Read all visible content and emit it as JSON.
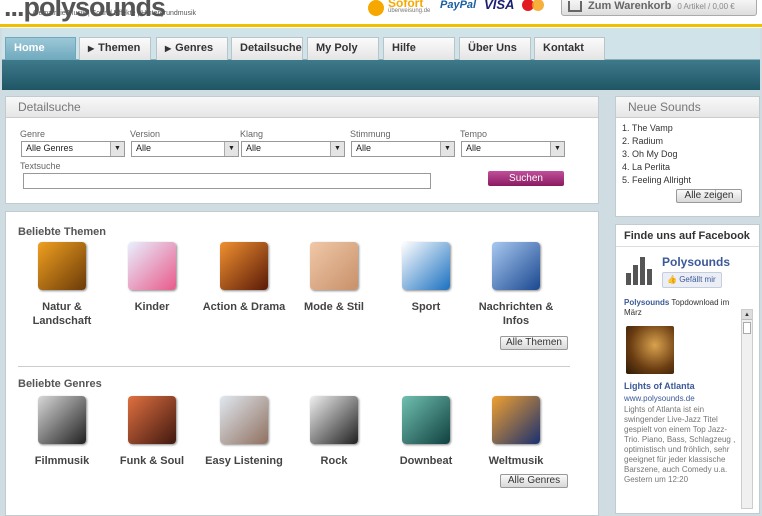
{
  "header": {
    "logo": "...polysounds",
    "tagline": "Gemafreie Musik | Sound Effekte | Hintergrundmusik",
    "sofort_label": "Sofort",
    "sofort_sub": "überweisung.de",
    "paypal": "PayPal",
    "visa": "VISA",
    "cart_label": "Zum Warenkorb",
    "cart_count": "0 Artikel / 0,00 €"
  },
  "nav": {
    "items": [
      {
        "label": "Home",
        "has_arrow": false,
        "active": true
      },
      {
        "label": "Themen",
        "has_arrow": true,
        "active": false
      },
      {
        "label": "Genres",
        "has_arrow": true,
        "active": false
      },
      {
        "label": "Detailsuche",
        "has_arrow": false,
        "active": false
      },
      {
        "label": "My Poly",
        "has_arrow": false,
        "active": false
      },
      {
        "label": "Hilfe",
        "has_arrow": false,
        "active": false
      },
      {
        "label": "Über Uns",
        "has_arrow": false,
        "active": false
      },
      {
        "label": "Kontakt",
        "has_arrow": false,
        "active": false
      }
    ],
    "arrow_glyph": "▶"
  },
  "search": {
    "title": "Detailsuche",
    "filters": [
      {
        "label": "Genre",
        "value": "Alle Genres"
      },
      {
        "label": "Version",
        "value": "Alle"
      },
      {
        "label": "Klang",
        "value": "Alle"
      },
      {
        "label": "Stimmung",
        "value": "Alle"
      },
      {
        "label": "Tempo",
        "value": "Alle"
      }
    ],
    "dropdown_glyph": "▼",
    "text_label": "Textsuche",
    "text_value": "",
    "button": "Suchen"
  },
  "themes": {
    "title": "Beliebte Themen",
    "items": [
      {
        "label": "Natur & Landschaft",
        "icon": "savanna-sunset-icon",
        "colors": [
          "#f0a020",
          "#6a3a08"
        ]
      },
      {
        "label": "Kinder",
        "icon": "child-icon",
        "colors": [
          "#e8f0ff",
          "#e85a8a"
        ]
      },
      {
        "label": "Action & Drama",
        "icon": "couple-fire-icon",
        "colors": [
          "#f09030",
          "#5a1a08"
        ]
      },
      {
        "label": "Mode & Stil",
        "icon": "eye-lashes-icon",
        "colors": [
          "#f0c8a8",
          "#c8906a"
        ]
      },
      {
        "label": "Sport",
        "icon": "surfer-icon",
        "colors": [
          "#ffffff",
          "#1a70c0"
        ]
      },
      {
        "label": "Nachrichten & Infos",
        "icon": "news-icon",
        "colors": [
          "#a8c8f0",
          "#1a4890"
        ]
      }
    ],
    "all_button": "Alle Themen"
  },
  "genres": {
    "title": "Beliebte Genres",
    "items": [
      {
        "label": "Filmmusik",
        "icon": "clapperboard-icon",
        "colors": [
          "#d8d8d8",
          "#202020"
        ]
      },
      {
        "label": "Funk & Soul",
        "icon": "afro-person-icon",
        "colors": [
          "#e07040",
          "#401810"
        ]
      },
      {
        "label": "Easy Listening",
        "icon": "pier-icon",
        "colors": [
          "#e0e8f0",
          "#907060"
        ]
      },
      {
        "label": "Rock",
        "icon": "rock-guitarist-icon",
        "colors": [
          "#f0f0f0",
          "#202020"
        ]
      },
      {
        "label": "Downbeat",
        "icon": "lounge-icon",
        "colors": [
          "#70c0b0",
          "#104040"
        ]
      },
      {
        "label": "Weltmusik",
        "icon": "world-dancer-icon",
        "colors": [
          "#f0a030",
          "#1a3070"
        ]
      }
    ],
    "all_button": "Alle Genres"
  },
  "neue_sounds": {
    "title": "Neue Sounds",
    "items": [
      "1. The Vamp",
      "2. Radium",
      "3. Oh My Dog",
      "4. La Perlita",
      "5. Feeling Allright"
    ],
    "button": "Alle zeigen"
  },
  "facebook": {
    "title": "Finde uns auf Facebook",
    "page_name": "Polysounds",
    "like": "Gefällt mir",
    "post_author": "Polysounds",
    "post_text": "Topdownload im März",
    "item_title": "Lights of Atlanta",
    "item_url": "www.polysounds.de",
    "item_desc": "Lights of Atlanta ist ein swingender Live-Jazz Titel gespielt von einem Top Jazz-Trio. Piano, Bass, Schlagzeug , optimistisch und fröhlich, sehr geeignet für jeder klassische Barszene, auch Comedy u.a.",
    "more": "Gestern um 12:20"
  }
}
